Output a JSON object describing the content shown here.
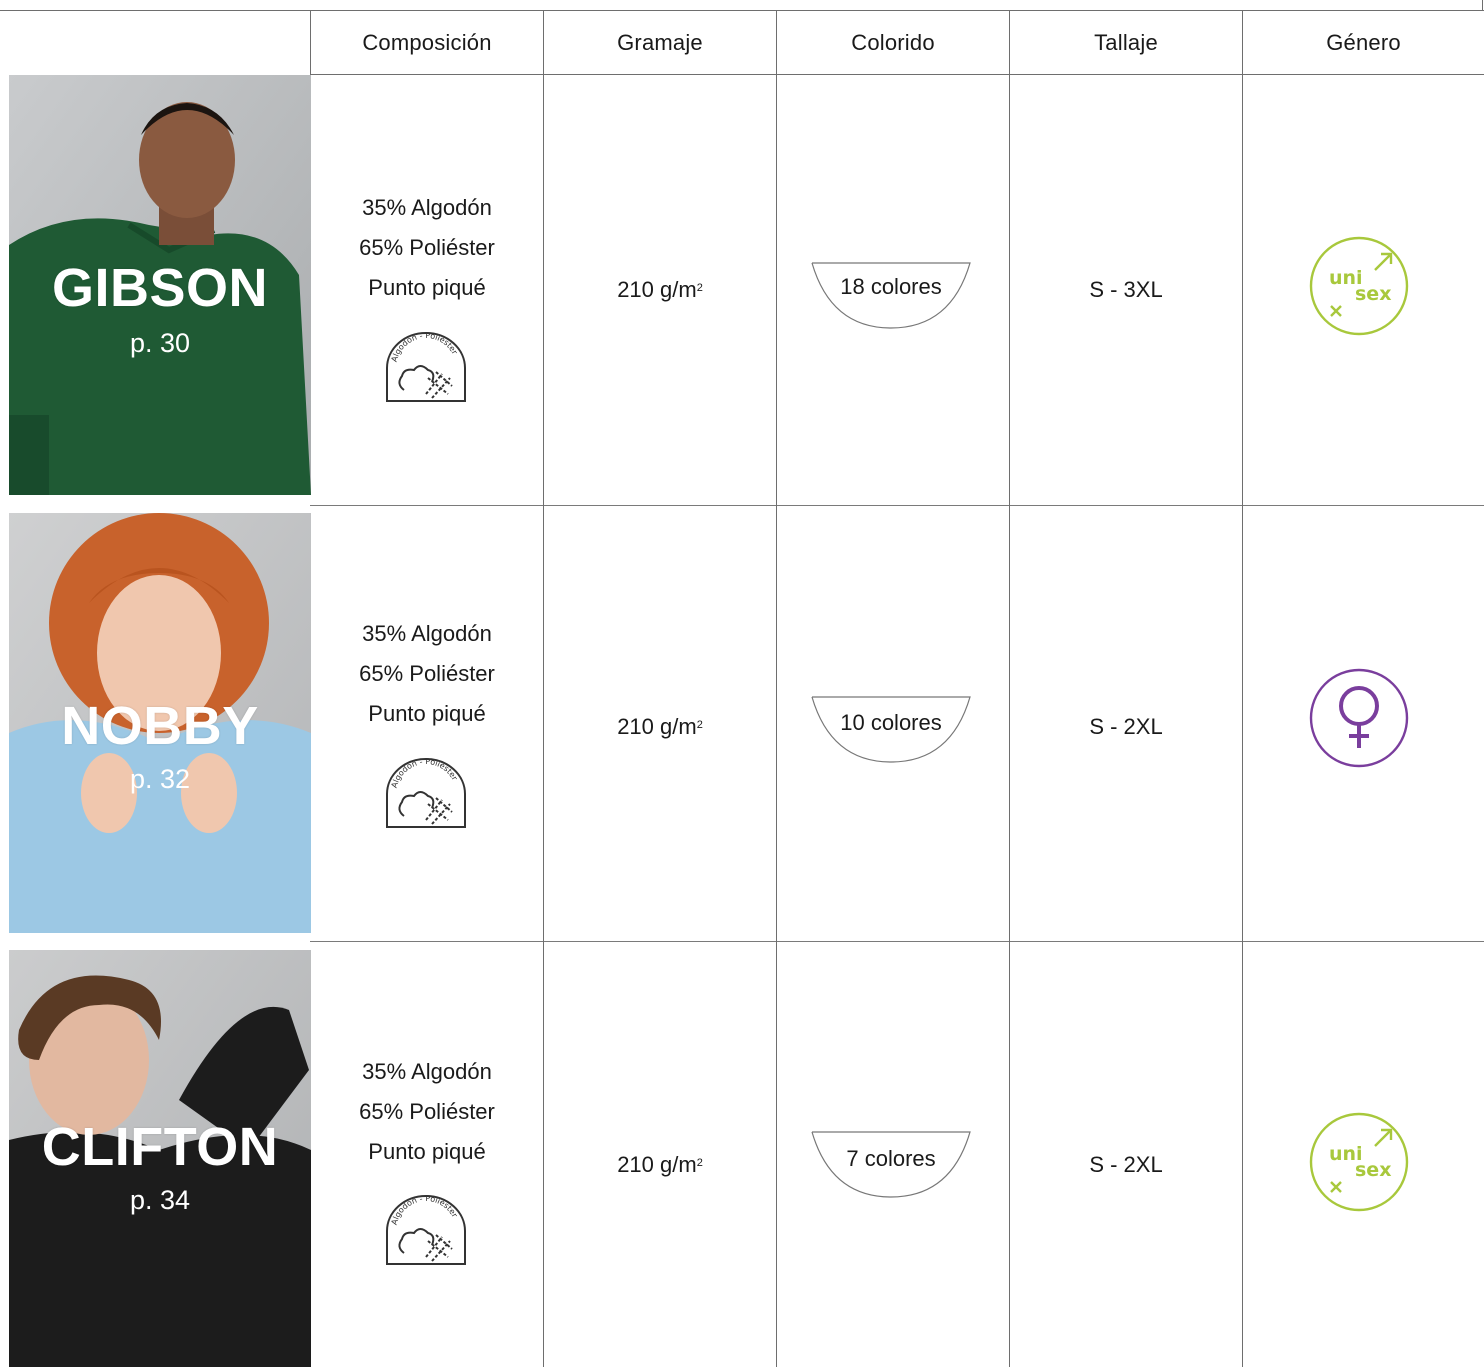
{
  "headers": {
    "composition": "Composición",
    "weight": "Gramaje",
    "colors": "Colorido",
    "sizes": "Tallaje",
    "gender": "Género"
  },
  "rows": [
    {
      "name": "GIBSON",
      "page": "p. 30",
      "composition": [
        "35% Algodón",
        "65% Poliéster",
        "Punto piqué"
      ],
      "fabric_icon": "cotton-polyester-badge-icon",
      "fabric_icon_text": "Algodón - Poliéster",
      "weight": "210 g/m",
      "weight_unit_sup": "2",
      "colors": "18 colores",
      "sizes": "S - 3XL",
      "gender_icon": "unisex-icon",
      "gender_text_1": "uni",
      "gender_text_2": "sex",
      "gender_color": "#a8c83c",
      "shirt_color": "#1f5a34"
    },
    {
      "name": "NOBBY",
      "page": "p. 32",
      "composition": [
        "35% Algodón",
        "65% Poliéster",
        "Punto piqué"
      ],
      "fabric_icon": "cotton-polyester-badge-icon",
      "fabric_icon_text": "Algodón - Poliéster",
      "weight": "210 g/m",
      "weight_unit_sup": "2",
      "colors": "10 colores",
      "sizes": "S - 2XL",
      "gender_icon": "female-icon",
      "gender_color": "#7a3e9d",
      "shirt_color": "#9cc8e4"
    },
    {
      "name": "CLIFTON",
      "page": "p. 34",
      "composition": [
        "35% Algodón",
        "65% Poliéster",
        "Punto piqué"
      ],
      "fabric_icon": "cotton-polyester-badge-icon",
      "fabric_icon_text": "Algodón - Poliéster",
      "weight": "210 g/m",
      "weight_unit_sup": "2",
      "colors": "7 colores",
      "sizes": "S - 2XL",
      "gender_icon": "unisex-icon",
      "gender_text_1": "uni",
      "gender_text_2": "sex",
      "gender_color": "#a8c83c",
      "shirt_color": "#1c1c1c"
    }
  ]
}
